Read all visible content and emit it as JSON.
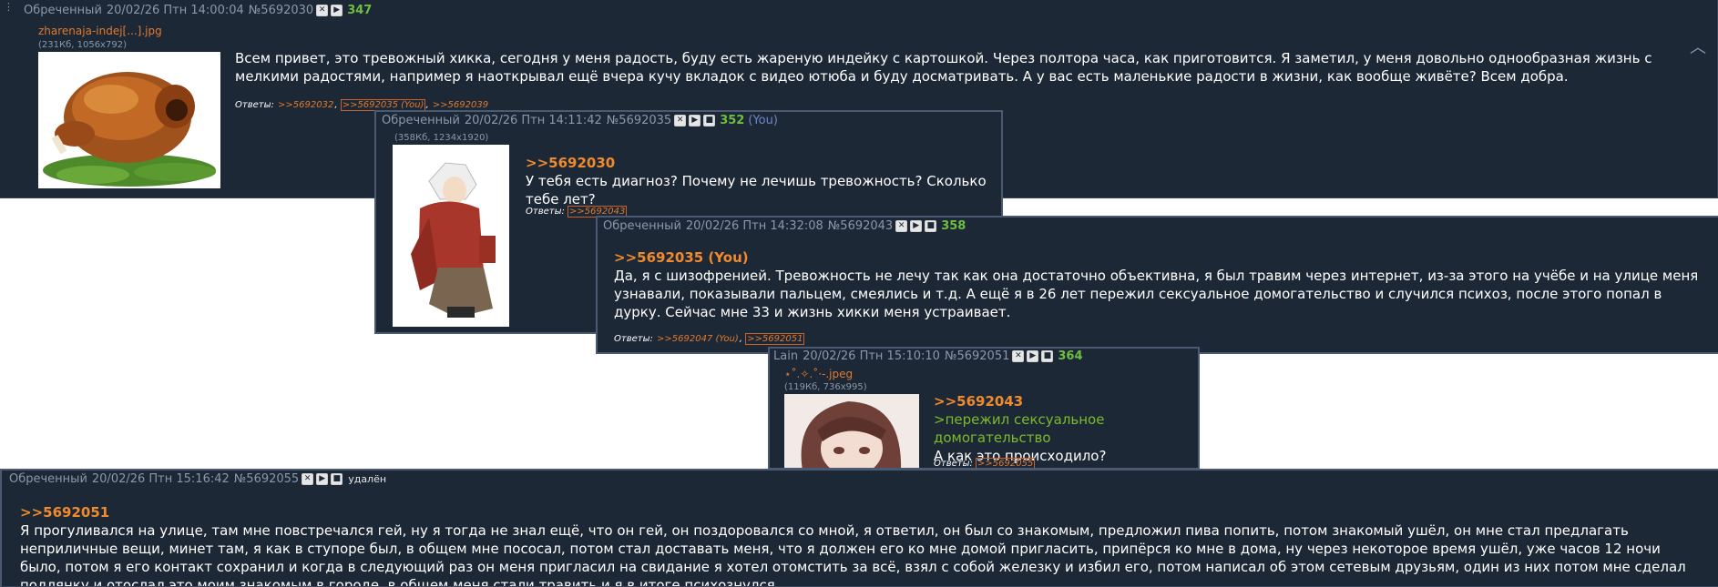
{
  "icons": {
    "delete": "✕",
    "play": "▶",
    "stop": "■"
  },
  "replies_label": "Ответы:",
  "posts": [
    {
      "author": "Обреченный",
      "date": "20/02/26 Птн 14:00:04",
      "num": "№5692030",
      "count": "347",
      "file_name": "zharenaja-indej[...].jpg",
      "file_info": "(231Кб, 1056x792)",
      "thumb_icon": "roast-turkey-image",
      "text": "Всем привет, это тревожный хикка, сегодня у меня радость, буду есть жареную индейку с картошкой. Через полтора часа, как приготовится. Я заметил, у меня довольно однообразная жизнь с мелкими радостями, например я наоткрывал ещё вчера кучу вкладок с видео ютюба и буду досматривать. А у вас есть маленькие радости в жизни, как вообще живёте? Всем добра.",
      "replies": [
        ">>5692032",
        ">>5692035 (You)",
        ">>5692039"
      ]
    },
    {
      "author": "Обреченный",
      "date": "20/02/26 Птн 14:11:42",
      "num": "№5692035",
      "count": "352",
      "you": "(You)",
      "file_info": "(358Кб, 1234x1920)",
      "thumb_icon": "anime-character-image",
      "quote": ">>5692030",
      "text": "У тебя есть диагноз? Почему не лечишь тревожность? Сколько тебе лет?",
      "replies": [
        ">>5692043"
      ]
    },
    {
      "author": "Обреченный",
      "date": "20/02/26 Птн 14:32:08",
      "num": "№5692043",
      "count": "358",
      "quote": ">>5692035 (You)",
      "text": "Да, я с шизофренией. Тревожность не лечу так как она достаточно объективна, я был травим через интернет, из-за этого на учёбе и на улице меня узнавали, показывали пальцем, смеялись и т.д. А ещё я в 26 лет пережил сексуальное домогательство и случился психоз, после этого попал в дурку. Сейчас мне 33 и жизнь хикки меня устраивает.",
      "replies": [
        ">>5692047 (You)",
        ">>5692051"
      ]
    },
    {
      "author": "Lain",
      "date": "20/02/26 Птн 15:10:10",
      "num": "№5692051",
      "count": "364",
      "file_name": "⋆˚.✧.˚·-.jpeg",
      "file_info": "(119Кб, 736x995)",
      "thumb_icon": "anime-portrait-image",
      "quote": ">>5692043",
      "greentext": ">пережил сексуальное домогательство",
      "text": "А как это происходило?",
      "replies": [
        ">>5692055"
      ]
    },
    {
      "author": "Обреченный",
      "date": "20/02/26 Птн 15:16:42",
      "num": "№5692055",
      "status": "удалён",
      "quote": ">>5692051",
      "text": "Я прогуливался на улице, там мне повстречался гей, ну я тогда не знал ещё, что он гей, он поздоровался со мной, я ответил, он был со знакомым, предложил пива попить, потом знакомый ушёл, он мне стал предлагать неприличные вещи, минет там, я как в ступоре был, в общем мне пососал, потом стал доставать меня, что я должен его ко мне домой пригласить, припёрся ко мне в дома, ну через некоторое время ушёл, уже часов 12 ночи было, потом я его контакт сохранил и когда в следующий раз он меня пригласил на свидание я хотел отомстить за всё, взял с собой железку и избил его, потом написал об этом сетевым друзьям, один из них потом мне сделал подлянку и отослал это моим знакомым в городе, в общем меня стали травить и я в итоге психознулся."
    }
  ]
}
